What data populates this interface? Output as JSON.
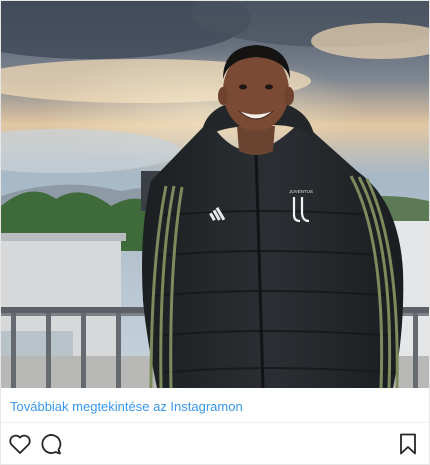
{
  "post": {
    "photo": {
      "jersey_badge_text": "JUVENTUS"
    },
    "view_more_link": "Továbbiak megtekintése az Instagramon",
    "actions": {
      "like_icon": "heart-outline-icon",
      "comment_icon": "speech-bubble-icon",
      "save_icon": "bookmark-icon"
    }
  }
}
